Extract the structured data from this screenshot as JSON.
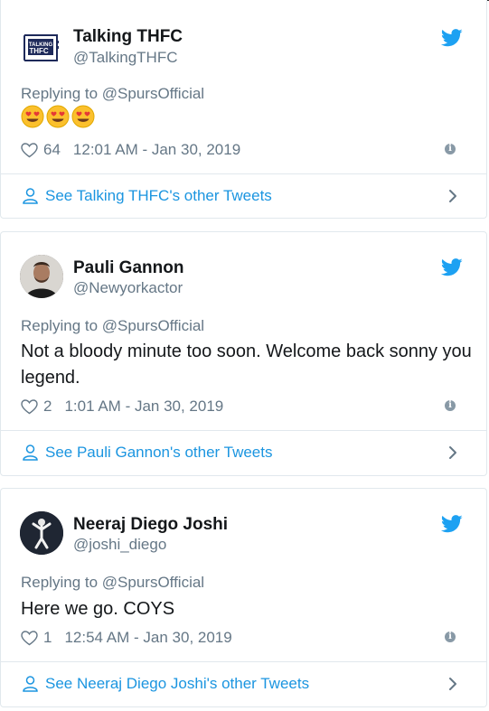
{
  "colors": {
    "accent": "#1b95e0",
    "muted": "#657786",
    "border": "#e1e8ed",
    "twitter_blue": "#1da1f2"
  },
  "tweets": [
    {
      "display_name": "Talking THFC",
      "handle": "@TalkingTHFC",
      "avatar_text": "TALKING THFC",
      "replying_to": "Replying to @SpursOfficial",
      "text": "",
      "emojis": [
        "heart-eyes",
        "heart-eyes",
        "heart-eyes"
      ],
      "likes": "64",
      "timestamp": "12:01 AM - Jan 30, 2019",
      "other_tweets_label": "See Talking THFC's other Tweets"
    },
    {
      "display_name": "Pauli Gannon",
      "handle": "@Newyorkactor",
      "replying_to": "Replying to @SpursOfficial",
      "text": "Not a bloody minute too soon.  Welcome back sonny you legend.",
      "likes": "2",
      "timestamp": "1:01 AM - Jan 30, 2019",
      "other_tweets_label": "See Pauli Gannon's other Tweets"
    },
    {
      "display_name": "Neeraj Diego Joshi",
      "handle": "@joshi_diego",
      "replying_to": "Replying to @SpursOfficial",
      "text": "Here we go. COYS",
      "likes": "1",
      "timestamp": "12:54 AM - Jan 30, 2019",
      "other_tweets_label": "See Neeraj Diego Joshi's other Tweets"
    }
  ]
}
